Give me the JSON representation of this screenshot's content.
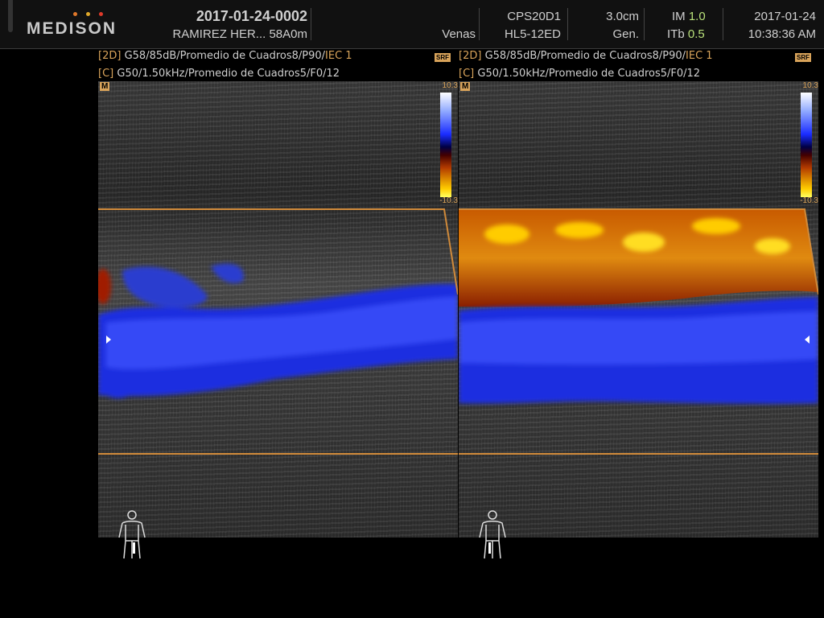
{
  "header": {
    "brand": "MEDISON",
    "patient_id": "2017-01-24-0002",
    "patient_name": "RAMIREZ HER... 58A0m",
    "application": "Venas",
    "preset": "CPS20D1",
    "probe": "HL5-12ED",
    "depth": "3.0cm",
    "gen": "Gen.",
    "im_label": "IM",
    "im_value": "1.0",
    "itb_label": "ITb",
    "itb_value": "0.5",
    "date": "2017-01-24",
    "time": "10:38:36 AM"
  },
  "panels": [
    {
      "mode_2d_tag": "[2D]",
      "mode_2d_params": "G58/85dB/Promedio de Cuadros8/P90/",
      "iec": "IEC 1",
      "mode_c_tag": "[C]",
      "mode_c_params": "G50/1.50kHz/Promedio de Cuadros5/F0/12",
      "srf": "SRF",
      "scale_top": "10.3",
      "scale_bottom": "-10.3",
      "m_label": "M"
    },
    {
      "mode_2d_tag": "[2D]",
      "mode_2d_params": "G58/85dB/Promedio de Cuadros8/P90/",
      "iec": "IEC 1",
      "mode_c_tag": "[C]",
      "mode_c_params": "G50/1.50kHz/Promedio de Cuadros5/F0/12",
      "srf": "SRF",
      "scale_top": "10.3",
      "scale_bottom": "-10.3",
      "m_label": "M"
    }
  ],
  "icons": {
    "body_marker": "body-marker-icon",
    "side_marker": "orientation-marker-icon"
  },
  "colors": {
    "accent_orange": "#d08a3a",
    "flow_blue": "#1a2cff",
    "flow_red": "#b33b00",
    "flow_yellow": "#ffcc00",
    "highlight_green": "#b8e07a",
    "logo_dot_1": "#e0782a",
    "logo_dot_2": "#e0a82a",
    "logo_dot_3": "#e03a2a"
  }
}
